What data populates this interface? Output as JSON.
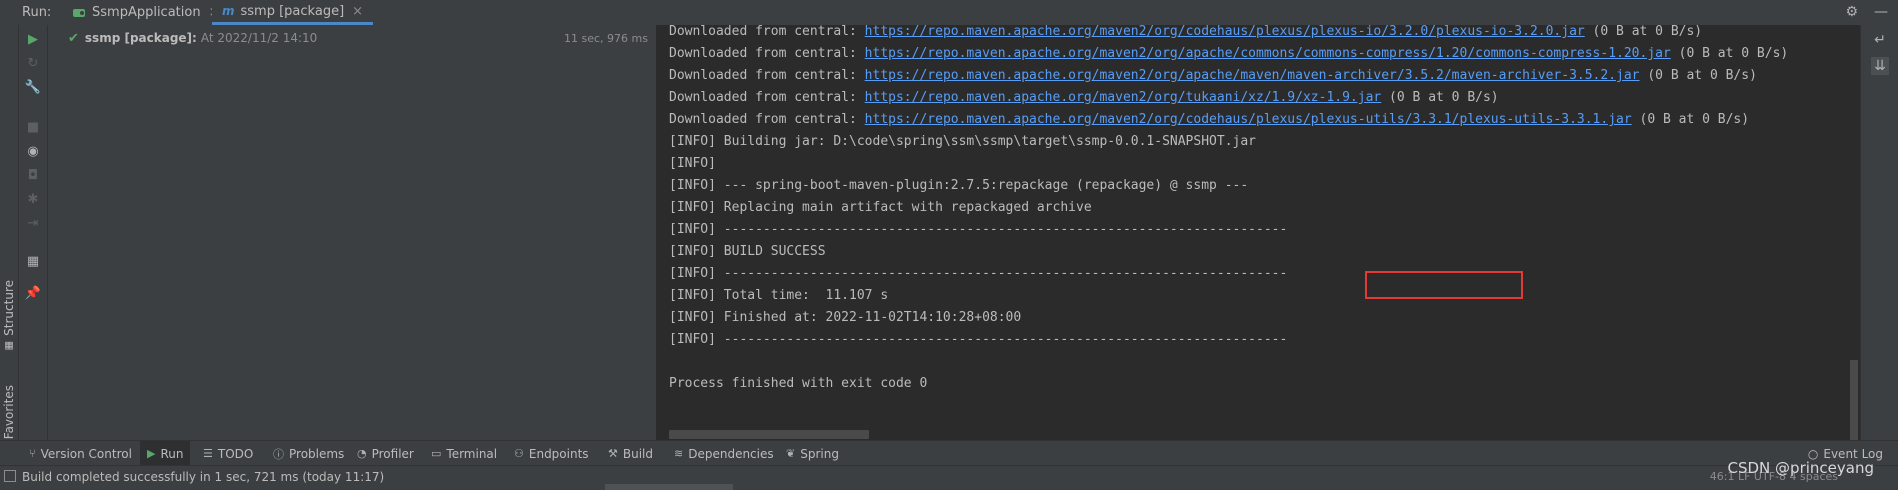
{
  "run_bar": {
    "label": "Run:",
    "tabs": [
      {
        "label": "SsmpApplication",
        "close": "×"
      },
      {
        "label": "ssmp [package]",
        "close": "×"
      }
    ]
  },
  "run_tree": {
    "item_name": "ssmp [package]:",
    "item_at": "At 2022/11/2 14:10",
    "duration": "11 sec, 976 ms"
  },
  "console": {
    "lines": [
      {
        "prefix": "Downloaded from central: ",
        "url": "https://repo.maven.apache.org/maven2/org/codehaus/plexus/plexus-io/3.2.0/plexus-io-3.2.0.jar",
        "suffix": " (0 B at 0 B/s)"
      },
      {
        "prefix": "Downloaded from central: ",
        "url": "https://repo.maven.apache.org/maven2/org/apache/commons/commons-compress/1.20/commons-compress-1.20.jar",
        "suffix": " (0 B at 0 B/s)"
      },
      {
        "prefix": "Downloaded from central: ",
        "url": "https://repo.maven.apache.org/maven2/org/apache/maven/maven-archiver/3.5.2/maven-archiver-3.5.2.jar",
        "suffix": " (0 B at 0 B/s)"
      },
      {
        "prefix": "Downloaded from central: ",
        "url": "https://repo.maven.apache.org/maven2/org/tukaani/xz/1.9/xz-1.9.jar",
        "suffix": " (0 B at 0 B/s)"
      },
      {
        "prefix": "Downloaded from central: ",
        "url": "https://repo.maven.apache.org/maven2/org/codehaus/plexus/plexus-utils/3.3.1/plexus-utils-3.3.1.jar",
        "suffix": " (0 B at 0 B/s)"
      },
      {
        "text": "[INFO] Building jar: D:\\code\\spring\\ssm\\ssmp\\target\\ssmp-0.0.1-SNAPSHOT.jar"
      },
      {
        "text": "[INFO]"
      },
      {
        "text": "[INFO] --- spring-boot-maven-plugin:2.7.5:repackage (repackage) @ ssmp ---"
      },
      {
        "text": "[INFO] Replacing main artifact with repackaged archive"
      },
      {
        "text": "[INFO] ------------------------------------------------------------------------"
      },
      {
        "text": "[INFO] BUILD SUCCESS"
      },
      {
        "text": "[INFO] ------------------------------------------------------------------------"
      },
      {
        "text": "[INFO] Total time:  11.107 s"
      },
      {
        "text": "[INFO] Finished at: 2022-11-02T14:10:28+08:00"
      },
      {
        "text": "[INFO] ------------------------------------------------------------------------"
      },
      {
        "text": ""
      },
      {
        "text": "Process finished with exit code 0"
      }
    ]
  },
  "left_strip": {
    "structure": "Structure",
    "favorites": "Favorites"
  },
  "bottom_tools": [
    {
      "label": "Version Control",
      "icon": "branch-icon",
      "glyph": "⑂"
    },
    {
      "label": "Run",
      "icon": "run-icon",
      "glyph": "▶"
    },
    {
      "label": "TODO",
      "icon": "list-icon",
      "glyph": "☰"
    },
    {
      "label": "Problems",
      "icon": "info-icon",
      "glyph": "ⓘ"
    },
    {
      "label": "Profiler",
      "icon": "profiler-icon",
      "glyph": "◔"
    },
    {
      "label": "Terminal",
      "icon": "terminal-icon",
      "glyph": "▭"
    },
    {
      "label": "Endpoints",
      "icon": "endpoints-icon",
      "glyph": "⚇"
    },
    {
      "label": "Build",
      "icon": "hammer-icon",
      "glyph": "⚒"
    },
    {
      "label": "Dependencies",
      "icon": "layers-icon",
      "glyph": "≋"
    },
    {
      "label": "Spring",
      "icon": "leaf-icon",
      "glyph": "❦"
    }
  ],
  "event_log": {
    "label": "Event Log",
    "icon": "search-icon",
    "glyph": "○"
  },
  "statusbar": {
    "text": "Build completed successfully in 1 sec, 721 ms (today 11:17)",
    "right": "46:1   LF   UTF-8   4 spaces"
  },
  "watermark": "CSDN @princeyang",
  "colors": {
    "accent": "#4a88c7",
    "link": "#589df6",
    "success": "#59a869",
    "highlight": "#e53935"
  }
}
